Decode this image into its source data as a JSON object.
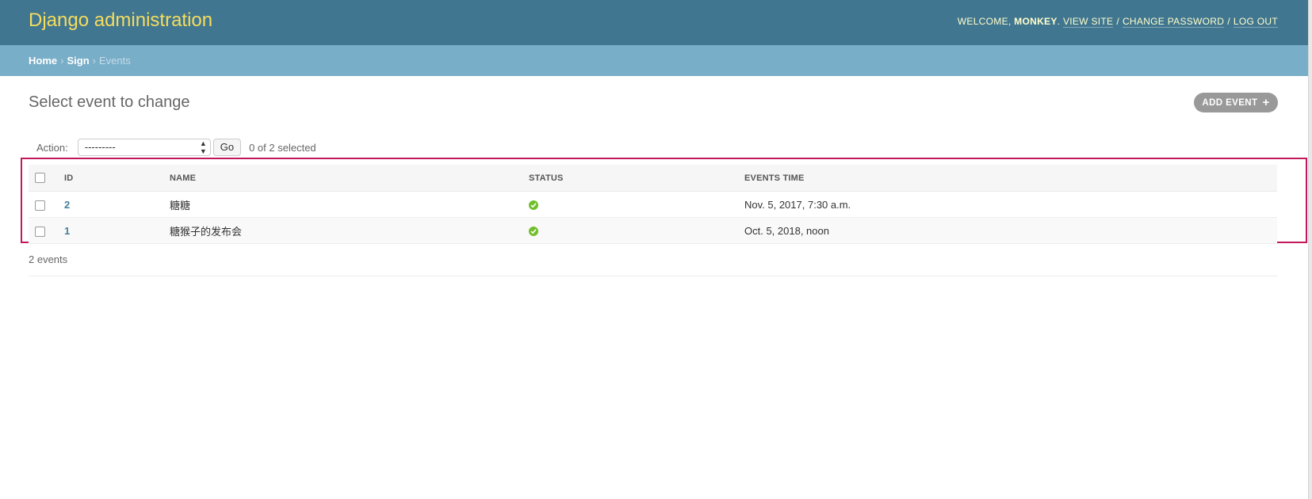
{
  "header": {
    "brand": "Django administration",
    "welcome_prefix": "WELCOME,",
    "username": "MONKEY",
    "username_suffix": ".",
    "view_site": "VIEW SITE",
    "change_password": "CHANGE PASSWORD",
    "log_out": "LOG OUT",
    "separator": "/"
  },
  "breadcrumbs": {
    "items": [
      "Home",
      "Sign",
      "Events"
    ],
    "arrow": "›"
  },
  "page": {
    "title": "Select event to change",
    "add_button": "ADD EVENT",
    "add_icon": "+"
  },
  "actions": {
    "label": "Action:",
    "selected_value": "---------",
    "go_button": "Go",
    "counter": "0 of 2 selected"
  },
  "table": {
    "columns": [
      "ID",
      "NAME",
      "STATUS",
      "EVENTS TIME"
    ],
    "rows": [
      {
        "id": "2",
        "name": "糖糖",
        "status": "check-circle-icon",
        "events_time": "Nov. 5, 2017, 7:30 a.m."
      },
      {
        "id": "1",
        "name": "糖猴子的发布会",
        "status": "check-circle-icon",
        "events_time": "Oct. 5, 2018, noon"
      }
    ]
  },
  "paginator": {
    "text": "2 events"
  },
  "colors": {
    "header_bg": "#417690",
    "brand": "#f5dd5d",
    "breadcrumbs_bg": "#79aec8",
    "link": "#447e9b",
    "status_ok": "#70bf2b",
    "highlight": "#c2185b"
  }
}
